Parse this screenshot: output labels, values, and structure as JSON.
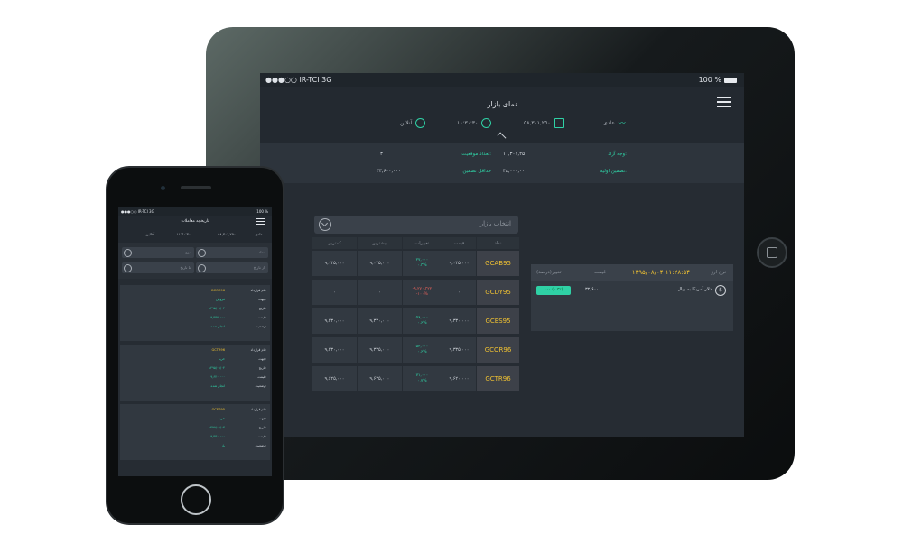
{
  "tablet": {
    "status": {
      "carrier": "●●●○○ IR-TCI  3G",
      "battery": "100 %"
    },
    "header": {
      "title": "نمای بازار",
      "stats": [
        {
          "icon": "wave-icon",
          "label": "عادی"
        },
        {
          "icon": "wallet-icon",
          "label": "۵۸,۳۰۱,۲۵۰"
        },
        {
          "icon": "clock-icon",
          "label": "۱۱:۳۰:۳۰"
        },
        {
          "icon": "globe-icon",
          "label": "آنلاین"
        }
      ]
    },
    "info": {
      "cash_label": "وجه آزاد:",
      "cash_value": "۱۰,۳۰۱,۲۵۰",
      "positions_label": "تعداد موقعیت:",
      "positions_value": "۳",
      "initial_margin_label": "تضمین اولیه:",
      "initial_margin_value": "۴۸,۰۰۰,۰۰۰",
      "min_margin_label": "حداقل تضمین",
      "min_margin_value": "۳۳,۶۰۰,۰۰۰"
    },
    "market_select": {
      "placeholder": "انتخاب بازار"
    },
    "market_table": {
      "columns": [
        "نماد",
        "قیمت",
        "تغییرات",
        "بیشترین",
        "کمترین"
      ],
      "rows": [
        {
          "symbol": "GCAB95",
          "price": "۹,۰۳۵,۰۰۰",
          "change": "۲۷,۰۰۰",
          "change_pct": "۰.۳%",
          "neg": false,
          "high": "۹,۰۳۵,۰۰۰",
          "low": "۹,۰۳۵,۰۰۰"
        },
        {
          "symbol": "GCDY95",
          "price": "۰",
          "change": "-۹,۲۷۰,۳۲۲",
          "change_pct": "-۱۰۰%",
          "neg": true,
          "high": "۰",
          "low": "۰"
        },
        {
          "symbol": "GCES95",
          "price": "۹,۳۳۰,۰۰۰",
          "change": "۵۶,۰۰۰",
          "change_pct": "۰.۶%",
          "neg": false,
          "high": "۹,۳۳۰,۰۰۰",
          "low": "۹,۳۳۰,۰۰۰"
        },
        {
          "symbol": "GCOR96",
          "price": "۹,۳۳۵,۰۰۰",
          "change": "۵۴,۰۰۰",
          "change_pct": "۰.۶%",
          "neg": false,
          "high": "۹,۳۳۵,۰۰۰",
          "low": "۹,۳۳۰,۰۰۰"
        },
        {
          "symbol": "GCTR96",
          "price": "۹,۶۲۰,۰۰۰",
          "change": "۷۱,۰۰۰",
          "change_pct": "۰.۷%",
          "neg": false,
          "high": "۹,۶۳۵,۰۰۰",
          "low": "۹,۶۲۵,۰۰۰"
        }
      ]
    },
    "rate_box": {
      "title": "نرخ ارز",
      "datetime": "۱۳۹۵/۰۸/۰۴ ۱۱:۲۸:۵۴",
      "price_label": "قیمت",
      "change_label": "تغییر(درصد)",
      "row_name": "دلار آمریکا به ریال",
      "row_price": "۳۲,۶۰۰",
      "row_change": "۱۰۰ (۰.۳٪)"
    }
  },
  "phone": {
    "status": {
      "carrier": "●●●○○ IR-TCI  3G",
      "battery": "100 %"
    },
    "title": "تاریخچه معاملات",
    "stats": [
      "عادی",
      "۵۸,۳۰۱,۲۵۰",
      "۱۱:۳۰:۳۰",
      "آفلاین"
    ],
    "filters": [
      "نماد",
      "نوع",
      "از تاریخ",
      "تا تاریخ"
    ],
    "cards": [
      {
        "symbol": "GCOR96",
        "lines": [
          {
            "k": "نام قرارداد:",
            "v": "GCOR96"
          },
          {
            "k": "جهت:",
            "v": "فروش"
          },
          {
            "k": "تاریخ:",
            "v": "۱۳۹۵/۰۸/۰۴"
          },
          {
            "k": "قیمت:",
            "v": "۹,۳۳۵,۰۰۰"
          },
          {
            "k": "وضعیت:",
            "v": "انجام شده"
          }
        ]
      },
      {
        "symbol": "GCTR96",
        "lines": [
          {
            "k": "نام قرارداد:",
            "v": "GCTR96"
          },
          {
            "k": "جهت:",
            "v": "خرید"
          },
          {
            "k": "تاریخ:",
            "v": "۱۳۹۵/۰۸/۰۴"
          },
          {
            "k": "قیمت:",
            "v": "۹,۶۲۰,۰۰۰"
          },
          {
            "k": "وضعیت:",
            "v": "انجام شده"
          }
        ]
      },
      {
        "symbol": "GCES95",
        "lines": [
          {
            "k": "نام قرارداد:",
            "v": "GCES95"
          },
          {
            "k": "جهت:",
            "v": "خرید"
          },
          {
            "k": "تاریخ:",
            "v": "۱۳۹۵/۰۸/۰۳"
          },
          {
            "k": "قیمت:",
            "v": "۹,۳۳۰,۰۰۰"
          },
          {
            "k": "وضعیت:",
            "v": "باز"
          }
        ]
      }
    ]
  },
  "colors": {
    "accent": "#2fd1a5",
    "symbol": "#f1c232",
    "negative": "#e0605a",
    "screen_bg": "#262c33"
  }
}
